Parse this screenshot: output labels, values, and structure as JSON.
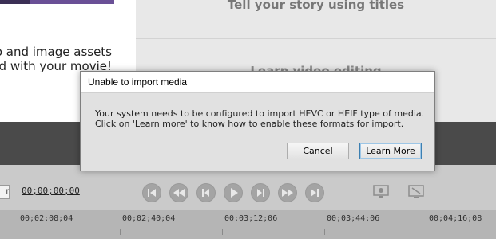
{
  "background": {
    "left_panel": {
      "line1": "video and image assets",
      "line2": "rted with your movie!"
    },
    "right_panel": {
      "title1": "Tell your story using titles",
      "title2": "Learn video editing"
    },
    "controls": {
      "timecode": "00;00;00;00",
      "box_text": "r"
    },
    "ruler": {
      "ticks": [
        "00;02;08;04",
        "00;02;40;04",
        "00;03;12;06",
        "00;03;44;06",
        "00;04;16;08"
      ]
    }
  },
  "dialog": {
    "title": "Unable to import media",
    "message": "Your system needs to be configured to import HEVC or HEIF type of media. Click on 'Learn more' to know how to enable these formats for import.",
    "cancel_label": "Cancel",
    "learn_more_label": "Learn More"
  },
  "colors": {
    "accent": "#3c7fb1",
    "dark_bar": "#4a4a4a",
    "thumbnail": "#6a5096"
  }
}
